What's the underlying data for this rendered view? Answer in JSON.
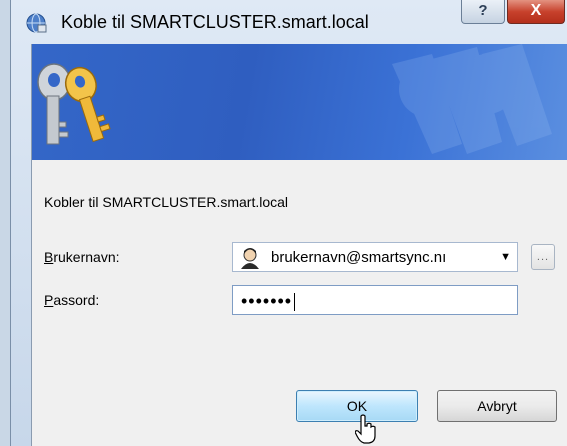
{
  "window": {
    "title": "Koble til SMARTCLUSTER.smart.local",
    "help_label": "?",
    "close_label": "X"
  },
  "dialog": {
    "connect_text": "Kobler til SMARTCLUSTER.smart.local",
    "username": {
      "label_access": "B",
      "label_rest": "rukernavn:",
      "value": "brukernavn@smartsync.nı"
    },
    "browse_label": "...",
    "password": {
      "label_access": "P",
      "label_rest": "assord:",
      "dots": "•••••••"
    },
    "ok_label": "OK",
    "cancel_label": "Avbryt"
  }
}
